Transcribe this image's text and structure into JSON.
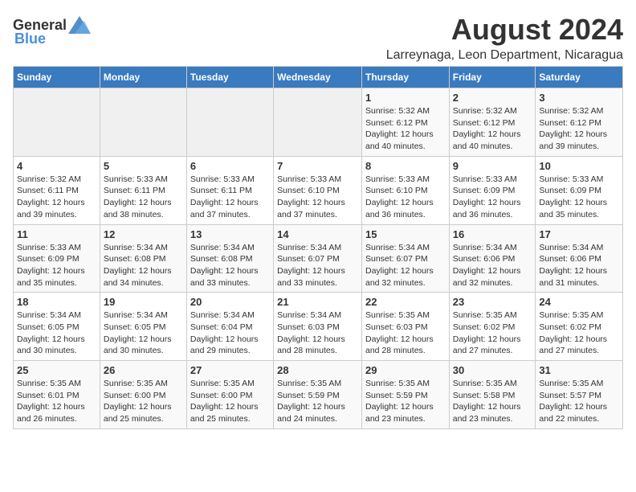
{
  "logo": {
    "general": "General",
    "blue": "Blue"
  },
  "title": {
    "month_year": "August 2024",
    "location": "Larreynaga, Leon Department, Nicaragua"
  },
  "days_of_week": [
    "Sunday",
    "Monday",
    "Tuesday",
    "Wednesday",
    "Thursday",
    "Friday",
    "Saturday"
  ],
  "weeks": [
    [
      {
        "day": "",
        "info": ""
      },
      {
        "day": "",
        "info": ""
      },
      {
        "day": "",
        "info": ""
      },
      {
        "day": "",
        "info": ""
      },
      {
        "day": "1",
        "info": "Sunrise: 5:32 AM\nSunset: 6:12 PM\nDaylight: 12 hours\nand 40 minutes."
      },
      {
        "day": "2",
        "info": "Sunrise: 5:32 AM\nSunset: 6:12 PM\nDaylight: 12 hours\nand 40 minutes."
      },
      {
        "day": "3",
        "info": "Sunrise: 5:32 AM\nSunset: 6:12 PM\nDaylight: 12 hours\nand 39 minutes."
      }
    ],
    [
      {
        "day": "4",
        "info": "Sunrise: 5:32 AM\nSunset: 6:11 PM\nDaylight: 12 hours\nand 39 minutes."
      },
      {
        "day": "5",
        "info": "Sunrise: 5:33 AM\nSunset: 6:11 PM\nDaylight: 12 hours\nand 38 minutes."
      },
      {
        "day": "6",
        "info": "Sunrise: 5:33 AM\nSunset: 6:11 PM\nDaylight: 12 hours\nand 37 minutes."
      },
      {
        "day": "7",
        "info": "Sunrise: 5:33 AM\nSunset: 6:10 PM\nDaylight: 12 hours\nand 37 minutes."
      },
      {
        "day": "8",
        "info": "Sunrise: 5:33 AM\nSunset: 6:10 PM\nDaylight: 12 hours\nand 36 minutes."
      },
      {
        "day": "9",
        "info": "Sunrise: 5:33 AM\nSunset: 6:09 PM\nDaylight: 12 hours\nand 36 minutes."
      },
      {
        "day": "10",
        "info": "Sunrise: 5:33 AM\nSunset: 6:09 PM\nDaylight: 12 hours\nand 35 minutes."
      }
    ],
    [
      {
        "day": "11",
        "info": "Sunrise: 5:33 AM\nSunset: 6:09 PM\nDaylight: 12 hours\nand 35 minutes."
      },
      {
        "day": "12",
        "info": "Sunrise: 5:34 AM\nSunset: 6:08 PM\nDaylight: 12 hours\nand 34 minutes."
      },
      {
        "day": "13",
        "info": "Sunrise: 5:34 AM\nSunset: 6:08 PM\nDaylight: 12 hours\nand 33 minutes."
      },
      {
        "day": "14",
        "info": "Sunrise: 5:34 AM\nSunset: 6:07 PM\nDaylight: 12 hours\nand 33 minutes."
      },
      {
        "day": "15",
        "info": "Sunrise: 5:34 AM\nSunset: 6:07 PM\nDaylight: 12 hours\nand 32 minutes."
      },
      {
        "day": "16",
        "info": "Sunrise: 5:34 AM\nSunset: 6:06 PM\nDaylight: 12 hours\nand 32 minutes."
      },
      {
        "day": "17",
        "info": "Sunrise: 5:34 AM\nSunset: 6:06 PM\nDaylight: 12 hours\nand 31 minutes."
      }
    ],
    [
      {
        "day": "18",
        "info": "Sunrise: 5:34 AM\nSunset: 6:05 PM\nDaylight: 12 hours\nand 30 minutes."
      },
      {
        "day": "19",
        "info": "Sunrise: 5:34 AM\nSunset: 6:05 PM\nDaylight: 12 hours\nand 30 minutes."
      },
      {
        "day": "20",
        "info": "Sunrise: 5:34 AM\nSunset: 6:04 PM\nDaylight: 12 hours\nand 29 minutes."
      },
      {
        "day": "21",
        "info": "Sunrise: 5:34 AM\nSunset: 6:03 PM\nDaylight: 12 hours\nand 28 minutes."
      },
      {
        "day": "22",
        "info": "Sunrise: 5:35 AM\nSunset: 6:03 PM\nDaylight: 12 hours\nand 28 minutes."
      },
      {
        "day": "23",
        "info": "Sunrise: 5:35 AM\nSunset: 6:02 PM\nDaylight: 12 hours\nand 27 minutes."
      },
      {
        "day": "24",
        "info": "Sunrise: 5:35 AM\nSunset: 6:02 PM\nDaylight: 12 hours\nand 27 minutes."
      }
    ],
    [
      {
        "day": "25",
        "info": "Sunrise: 5:35 AM\nSunset: 6:01 PM\nDaylight: 12 hours\nand 26 minutes."
      },
      {
        "day": "26",
        "info": "Sunrise: 5:35 AM\nSunset: 6:00 PM\nDaylight: 12 hours\nand 25 minutes."
      },
      {
        "day": "27",
        "info": "Sunrise: 5:35 AM\nSunset: 6:00 PM\nDaylight: 12 hours\nand 25 minutes."
      },
      {
        "day": "28",
        "info": "Sunrise: 5:35 AM\nSunset: 5:59 PM\nDaylight: 12 hours\nand 24 minutes."
      },
      {
        "day": "29",
        "info": "Sunrise: 5:35 AM\nSunset: 5:59 PM\nDaylight: 12 hours\nand 23 minutes."
      },
      {
        "day": "30",
        "info": "Sunrise: 5:35 AM\nSunset: 5:58 PM\nDaylight: 12 hours\nand 23 minutes."
      },
      {
        "day": "31",
        "info": "Sunrise: 5:35 AM\nSunset: 5:57 PM\nDaylight: 12 hours\nand 22 minutes."
      }
    ]
  ]
}
